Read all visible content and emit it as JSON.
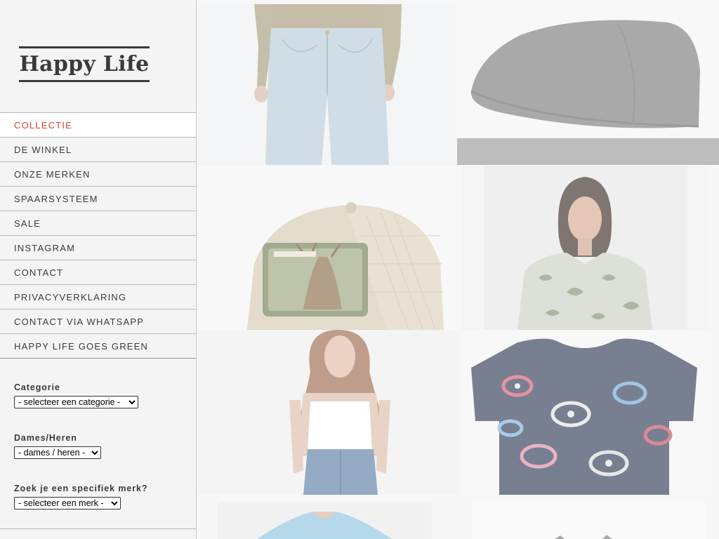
{
  "brand": {
    "logo_text": "Happy Life"
  },
  "nav": {
    "items": [
      {
        "label": "COLLECTIE",
        "active": true
      },
      {
        "label": "DE WINKEL"
      },
      {
        "label": "ONZE MERKEN"
      },
      {
        "label": "SPAARSYSTEEM"
      },
      {
        "label": "SALE"
      },
      {
        "label": "INSTAGRAM"
      },
      {
        "label": "CONTACT"
      },
      {
        "label": "PRIVACYVERKLARING"
      },
      {
        "label": "CONTACT VIA WHATSAPP"
      },
      {
        "label": "HAPPY LIFE GOES GREEN"
      }
    ]
  },
  "filters": {
    "category": {
      "label": "Categorie",
      "selected": "- selecteer een categorie -"
    },
    "gender": {
      "label": "Dames/Heren",
      "selected": "- dames / heren -"
    },
    "brand": {
      "label": "Zoek je een specifiek merk?",
      "selected": "- selecteer een merk -"
    }
  },
  "products": {
    "items": [
      {
        "icon": "jeans-model-icon"
      },
      {
        "icon": "flat-cap-icon"
      },
      {
        "icon": "trucker-cap-icon",
        "patch_text": "STEIN FEVER"
      },
      {
        "icon": "printed-blouse-model-icon"
      },
      {
        "icon": "white-top-model-icon"
      },
      {
        "icon": "printed-tshirt-icon"
      },
      {
        "icon": "light-blue-shirt-icon"
      },
      {
        "icon": "partial-item-icon"
      }
    ]
  },
  "colors": {
    "accent": "#d9412e",
    "text": "#3a3a3a",
    "sidebar_bg": "#f4f4f4",
    "divider": "#b9b9b9"
  }
}
